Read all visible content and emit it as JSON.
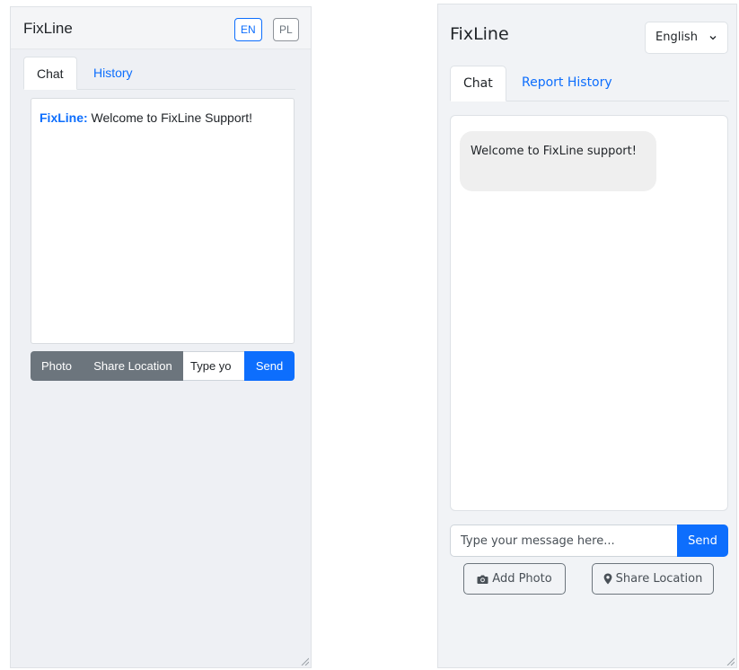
{
  "panel_a": {
    "title": "FixLine",
    "lang_en": "EN",
    "lang_pl": "PL",
    "tabs": [
      {
        "label": "Chat",
        "active": true
      },
      {
        "label": "History",
        "active": false
      }
    ],
    "message": {
      "sender": "FixLine:",
      "text": " Welcome to FixLine Support!"
    },
    "photo_label": "Photo",
    "location_label": "Share Location",
    "input_value": "Type yo",
    "send_label": "Send",
    "resize_grip_icon": "resize-grip-icon"
  },
  "panel_b": {
    "title": "FixLine",
    "language": "English",
    "tabs": [
      {
        "label": "Chat",
        "active": true
      },
      {
        "label": "Report History",
        "active": false
      }
    ],
    "bubble_text": "Welcome to FixLine support!",
    "input_placeholder": "Type your message here...",
    "send_label": "Send",
    "add_photo_label": "Add Photo",
    "share_location_label": "Share Location",
    "camera_icon": "camera-icon",
    "location_icon": "map-marker-icon",
    "resize_grip_icon": "resize-grip-icon"
  },
  "colors": {
    "accent": "#0d6efd",
    "secondary": "#6c757d",
    "panel_bg": "#eef0f4",
    "bubble_bg": "#efefef"
  }
}
